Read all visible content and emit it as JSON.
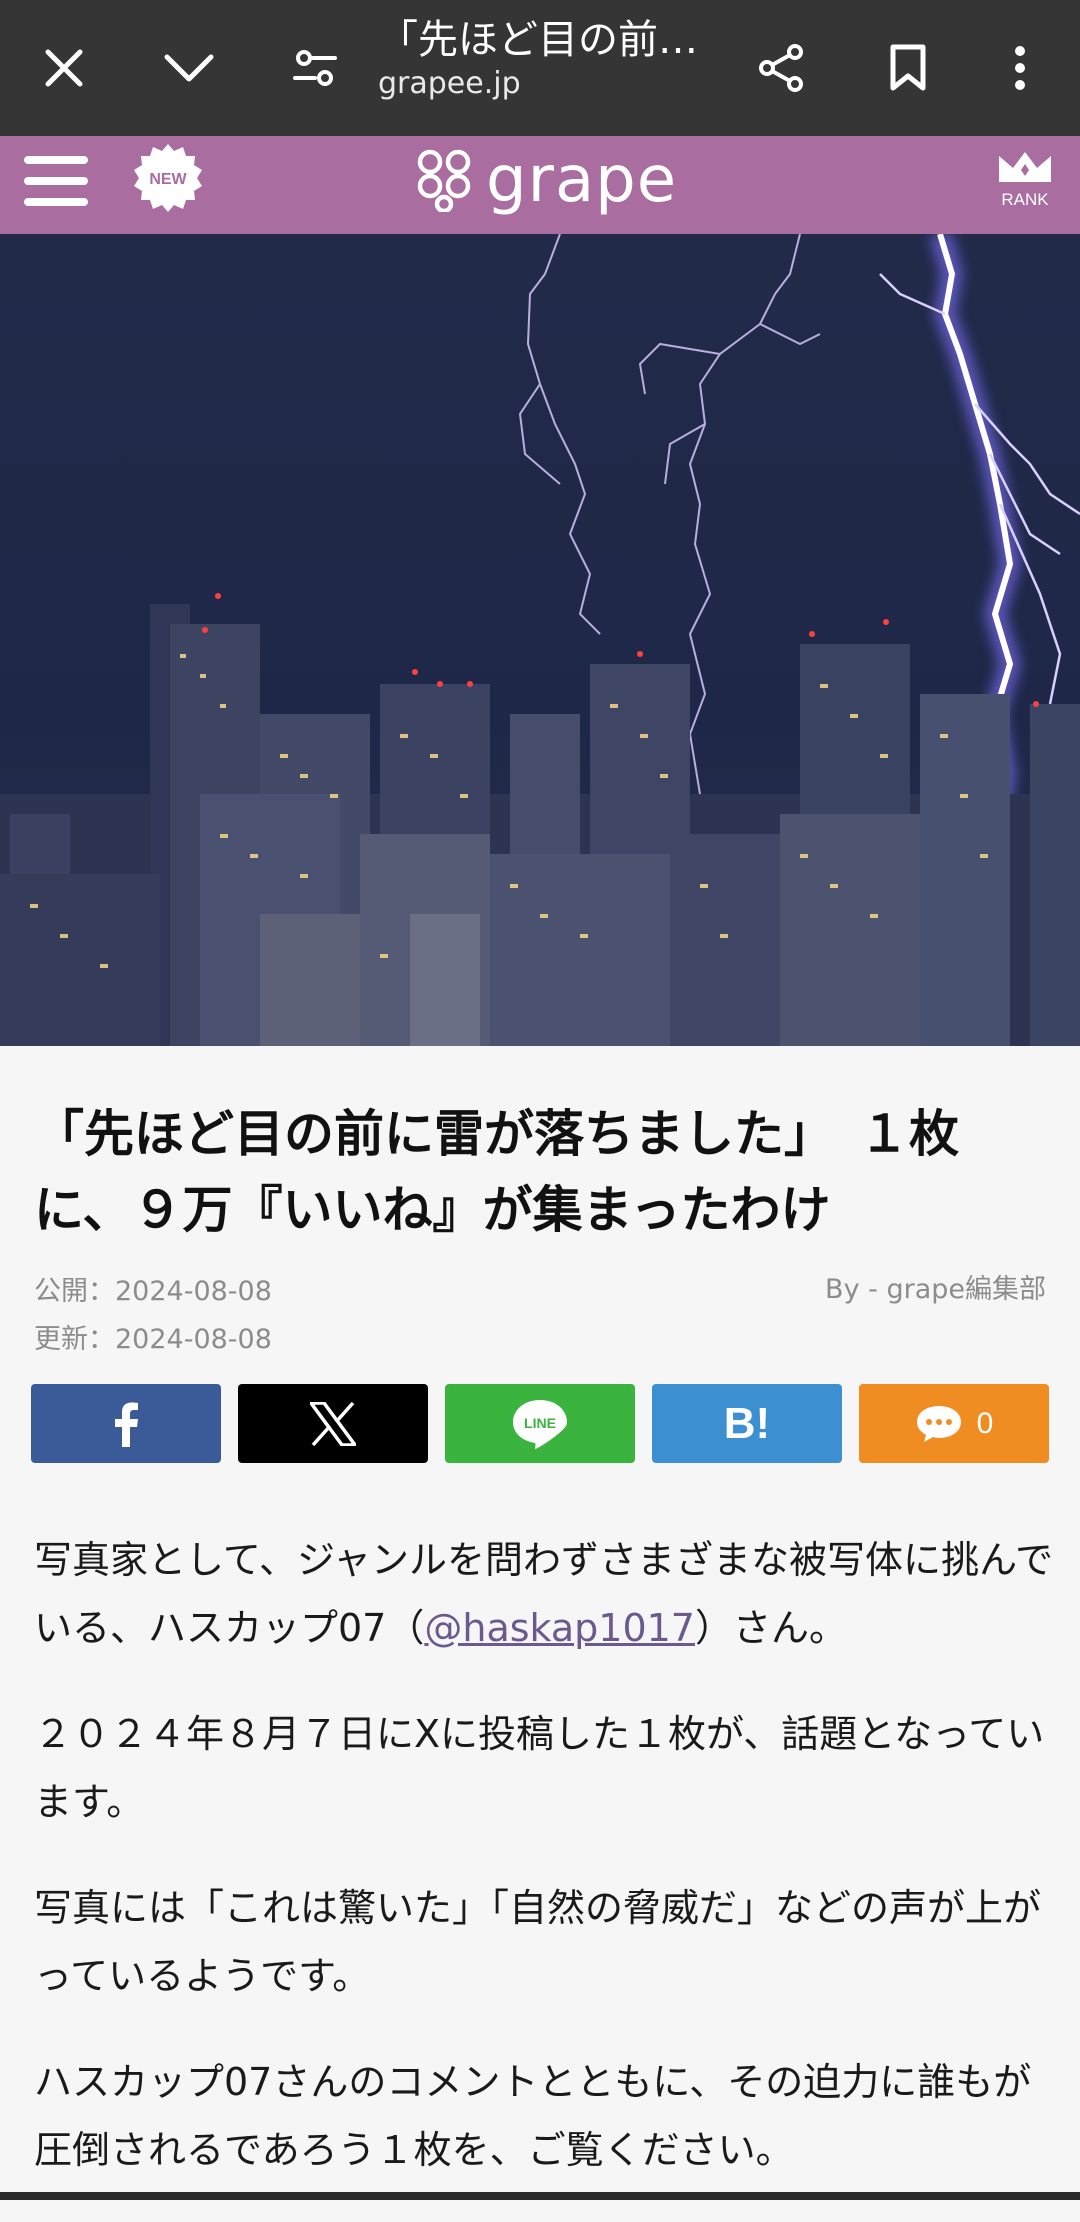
{
  "browser": {
    "tab_title": "「先ほど目の前…",
    "url": "grapee.jp"
  },
  "site": {
    "logo_text": "grape",
    "new_badge": "NEW",
    "rank_label": "RANK",
    "brand_color": "#a96da0"
  },
  "article": {
    "title": "「先ほど目の前に雷が落ちました」　１枚に、９万『いいね』が集まったわけ",
    "published": "公開：2024-08-08",
    "updated": "更新：2024-08-08",
    "author": "By - grape編集部",
    "share": {
      "facebook_label": "f",
      "hatena_label": "B!",
      "comment_count": "0"
    },
    "paragraphs": {
      "p1_before": "写真家として、ジャンルを問わずさまざまな被写体に挑んでいる、ハスカップ07（",
      "p1_link": "@haskap1017",
      "p1_after": "）さん。",
      "p2": "２０２４年８月７日にXに投稿した１枚が、話題となっています。",
      "p3": "写真には「これは驚いた」「自然の脅威だ」などの声が上がっているようです。",
      "p4": "ハスカップ07さんのコメントとともに、その迫力に誰もが圧倒されるであろう１枚を、ご覧ください。"
    }
  }
}
